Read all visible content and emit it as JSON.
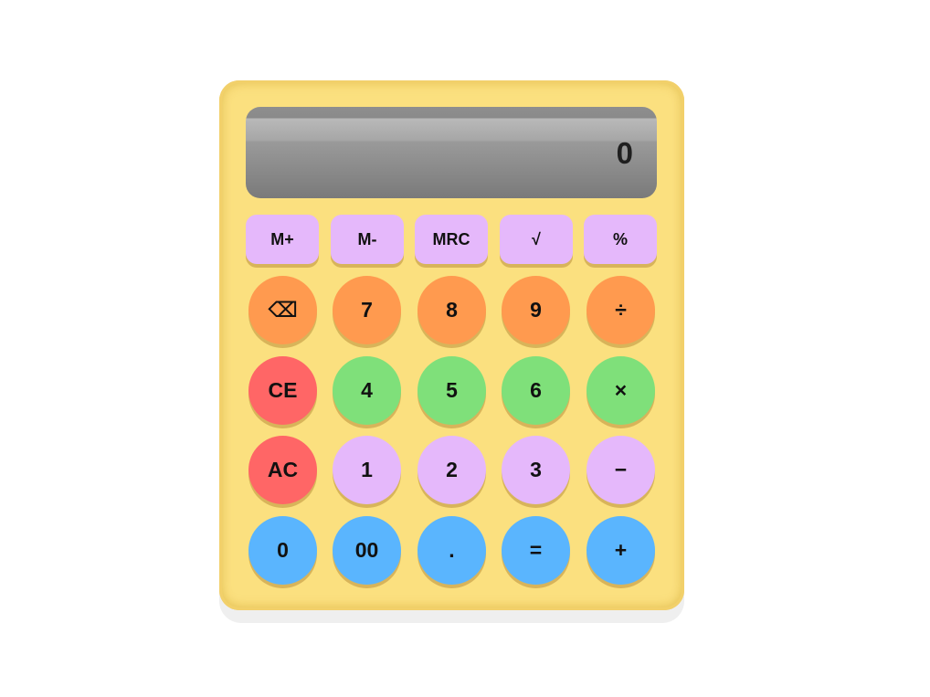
{
  "display": {
    "value": "0"
  },
  "memory_row": [
    {
      "label": "M+"
    },
    {
      "label": "M-"
    },
    {
      "label": "MRC"
    },
    {
      "label": "√"
    },
    {
      "label": "%"
    }
  ],
  "rows": [
    [
      {
        "label": "⌫",
        "color": "#ff9a4f"
      },
      {
        "label": "7",
        "color": "#ff9a4f"
      },
      {
        "label": "8",
        "color": "#ff9a4f"
      },
      {
        "label": "9",
        "color": "#ff9a4f"
      },
      {
        "label": "÷",
        "color": "#ff9a4f"
      }
    ],
    [
      {
        "label": "CE",
        "color": "#ff6666"
      },
      {
        "label": "4",
        "color": "#7fe07a"
      },
      {
        "label": "5",
        "color": "#7fe07a"
      },
      {
        "label": "6",
        "color": "#7fe07a"
      },
      {
        "label": "×",
        "color": "#7fe07a"
      }
    ],
    [
      {
        "label": "AC",
        "color": "#ff6666"
      },
      {
        "label": "1",
        "color": "#e5b8fb"
      },
      {
        "label": "2",
        "color": "#e5b8fb"
      },
      {
        "label": "3",
        "color": "#e5b8fb"
      },
      {
        "label": "−",
        "color": "#e5b8fb"
      }
    ],
    [
      {
        "label": "0",
        "color": "#5ab5fe"
      },
      {
        "label": "00",
        "color": "#5ab5fe"
      },
      {
        "label": ".",
        "color": "#5ab5fe"
      },
      {
        "label": "=",
        "color": "#5ab5fe"
      },
      {
        "label": "+",
        "color": "#5ab5fe"
      }
    ]
  ],
  "colors": {
    "body": "#fbe07f",
    "display": "#7a7a7a",
    "memory": "#e5b8fb"
  }
}
